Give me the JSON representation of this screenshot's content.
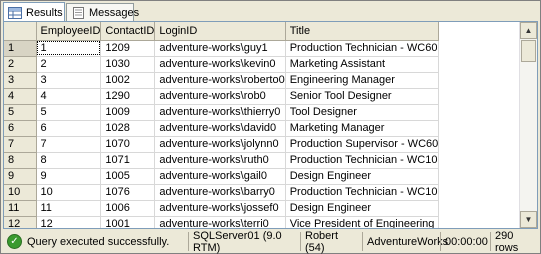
{
  "tabs": [
    {
      "label": "Results",
      "icon": "grid-icon"
    },
    {
      "label": "Messages",
      "icon": "messages-icon"
    }
  ],
  "columns": [
    "EmployeeID",
    "ContactID",
    "LoginID",
    "Title"
  ],
  "rows": [
    {
      "n": "1",
      "employee_id": "1",
      "contact_id": "1209",
      "login_id": "adventure-works\\guy1",
      "title": "Production Technician - WC60"
    },
    {
      "n": "2",
      "employee_id": "2",
      "contact_id": "1030",
      "login_id": "adventure-works\\kevin0",
      "title": "Marketing Assistant"
    },
    {
      "n": "3",
      "employee_id": "3",
      "contact_id": "1002",
      "login_id": "adventure-works\\roberto0",
      "title": "Engineering Manager"
    },
    {
      "n": "4",
      "employee_id": "4",
      "contact_id": "1290",
      "login_id": "adventure-works\\rob0",
      "title": "Senior Tool Designer"
    },
    {
      "n": "5",
      "employee_id": "5",
      "contact_id": "1009",
      "login_id": "adventure-works\\thierry0",
      "title": "Tool Designer"
    },
    {
      "n": "6",
      "employee_id": "6",
      "contact_id": "1028",
      "login_id": "adventure-works\\david0",
      "title": "Marketing Manager"
    },
    {
      "n": "7",
      "employee_id": "7",
      "contact_id": "1070",
      "login_id": "adventure-works\\jolynn0",
      "title": "Production Supervisor - WC60"
    },
    {
      "n": "8",
      "employee_id": "8",
      "contact_id": "1071",
      "login_id": "adventure-works\\ruth0",
      "title": "Production Technician - WC10"
    },
    {
      "n": "9",
      "employee_id": "9",
      "contact_id": "1005",
      "login_id": "adventure-works\\gail0",
      "title": "Design Engineer"
    },
    {
      "n": "10",
      "employee_id": "10",
      "contact_id": "1076",
      "login_id": "adventure-works\\barry0",
      "title": "Production Technician - WC10"
    },
    {
      "n": "11",
      "employee_id": "11",
      "contact_id": "1006",
      "login_id": "adventure-works\\jossef0",
      "title": "Design Engineer"
    },
    {
      "n": "12",
      "employee_id": "12",
      "contact_id": "1001",
      "login_id": "adventure-works\\terri0",
      "title": "Vice President of Engineering"
    }
  ],
  "status": {
    "message": "Query executed successfully.",
    "server": "SQLServer01 (9.0 RTM)",
    "user": "Robert (54)",
    "database": "AdventureWorks",
    "elapsed": "00:00:00",
    "rows": "290 rows"
  },
  "colors": {
    "status_ok": "#3a9a2f",
    "border": "#7f9db9"
  }
}
